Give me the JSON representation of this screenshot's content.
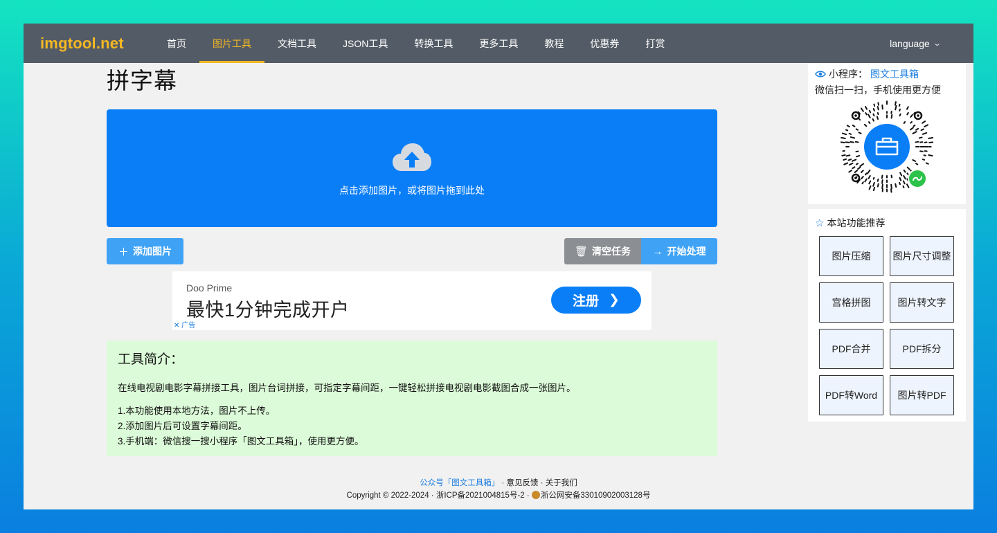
{
  "header": {
    "logo": "imgtool.net",
    "nav": [
      {
        "label": "首页",
        "active": false
      },
      {
        "label": "图片工具",
        "active": true
      },
      {
        "label": "文档工具",
        "active": false
      },
      {
        "label": "JSON工具",
        "active": false
      },
      {
        "label": "转换工具",
        "active": false
      },
      {
        "label": "更多工具",
        "active": false
      },
      {
        "label": "教程",
        "active": false
      },
      {
        "label": "优惠券",
        "active": false
      },
      {
        "label": "打赏",
        "active": false
      }
    ],
    "language": "language"
  },
  "main": {
    "title": "拼字幕",
    "dropzone_hint": "点击添加图片，或将图片拖到此处",
    "add_button": "添加图片",
    "clear_button": "清空任务",
    "start_button": "开始处理"
  },
  "ad": {
    "brand": "Doo Prime",
    "slogan": "最快1分钟完成开户",
    "cta": "注册",
    "tag": "广告"
  },
  "intro": {
    "heading": "工具简介：",
    "description": "在线电视剧电影字幕拼接工具，图片台词拼接，可指定字幕间距，一键轻松拼接电视剧电影截图合成一张图片。",
    "tips": [
      "1.本功能使用本地方法，图片不上传。",
      "2.添加图片后可设置字幕间距。",
      "3.手机端：微信搜一搜小程序「图文工具箱」，使用更方便。"
    ]
  },
  "sidebar": {
    "miniapp_label": "小程序：",
    "miniapp_name": "图文工具箱",
    "miniapp_hint": "微信扫一扫，手机使用更方便",
    "rec_title": "本站功能推荐",
    "tools": [
      "图片压缩",
      "图片尺寸调整",
      "宫格拼图",
      "图片转文字",
      "PDF合并",
      "PDF拆分",
      "PDF转Word",
      "图片转PDF"
    ]
  },
  "footer": {
    "wechat_link": "公众号「图文工具箱」",
    "sep": " · ",
    "feedback": "意见反馈",
    "about": "关于我们",
    "copyright": "Copyright © 2022-2024 · 浙ICP备2021004815号-2 · ",
    "police": "浙公网安备33010902003128号"
  },
  "colors": {
    "nav_bg": "#535c66",
    "accent": "#f5b823",
    "primary": "#0a7ef6",
    "button": "#3fa2f5",
    "intro_bg": "#dcfbd8"
  }
}
